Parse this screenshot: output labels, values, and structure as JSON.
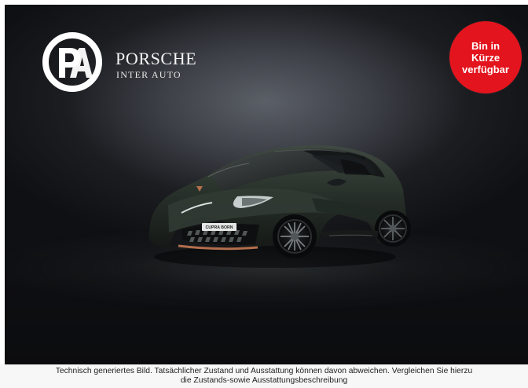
{
  "brand": {
    "name": "PORSCHE",
    "subtitle": "INTER AUTO",
    "logo_icon": "pia-logo-icon"
  },
  "badge": {
    "line1": "Bin in",
    "line2": "Kürze",
    "line3": "verfügbar",
    "color": "#e3141d"
  },
  "vehicle": {
    "plate": "CUPRA BORN",
    "primary_color": "#29312b",
    "accent_color": "#b5704e"
  },
  "caption": {
    "line1": "Technisch generiertes Bild. Tatsächlicher Zustand und Ausstattung können davon abweichen. Vergleichen Sie hierzu",
    "line2": "die Zustands-sowie Ausstattungsbeschreibung"
  }
}
